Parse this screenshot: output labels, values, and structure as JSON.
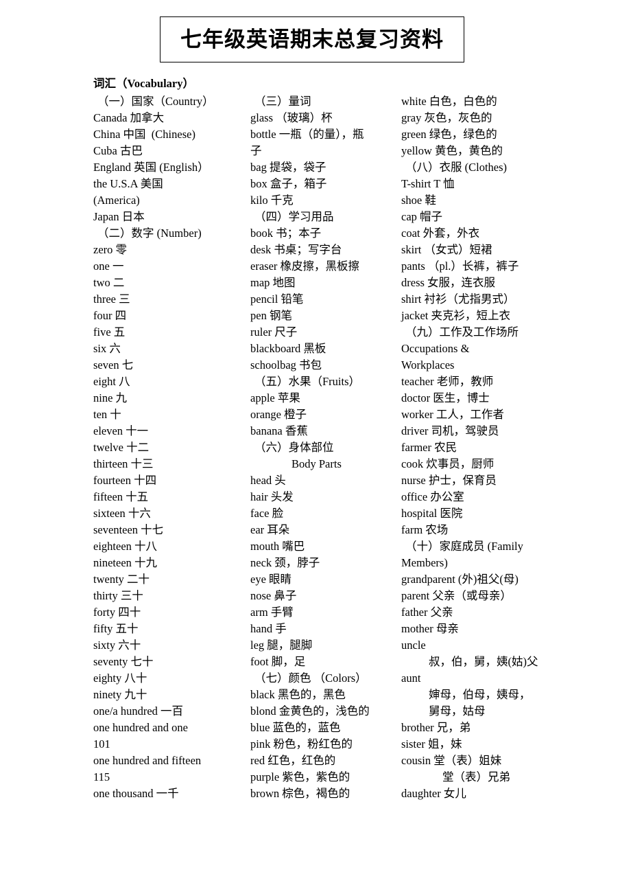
{
  "document": {
    "title": "七年级英语期末总复习资料",
    "section_heading": "词汇（Vocabulary）"
  },
  "columns": {
    "column_1": [
      {
        "text": "（一）国家（Country）",
        "style": "section"
      },
      {
        "text": "Canada 加拿大",
        "style": ""
      },
      {
        "text": "China 中国  (Chinese)",
        "style": ""
      },
      {
        "text": "Cuba 古巴",
        "style": ""
      },
      {
        "text": "England 英国 (English）",
        "style": ""
      },
      {
        "text": "the U.S.A 美国",
        "style": ""
      },
      {
        "text": "(America)",
        "style": ""
      },
      {
        "text": "Japan 日本",
        "style": ""
      },
      {
        "text": "（二）数字 (Number)",
        "style": "section"
      },
      {
        "text": "zero 零",
        "style": ""
      },
      {
        "text": "one 一",
        "style": ""
      },
      {
        "text": "two 二",
        "style": ""
      },
      {
        "text": "three 三",
        "style": ""
      },
      {
        "text": "four 四",
        "style": ""
      },
      {
        "text": "five 五",
        "style": ""
      },
      {
        "text": "six 六",
        "style": ""
      },
      {
        "text": "seven 七",
        "style": ""
      },
      {
        "text": "eight 八",
        "style": ""
      },
      {
        "text": "nine 九",
        "style": ""
      },
      {
        "text": "ten 十",
        "style": ""
      },
      {
        "text": "eleven 十一",
        "style": ""
      },
      {
        "text": "twelve 十二",
        "style": ""
      },
      {
        "text": "thirteen 十三",
        "style": ""
      },
      {
        "text": "fourteen 十四",
        "style": ""
      },
      {
        "text": "fifteen 十五",
        "style": ""
      },
      {
        "text": "sixteen 十六",
        "style": ""
      },
      {
        "text": "seventeen 十七",
        "style": ""
      },
      {
        "text": "eighteen 十八",
        "style": ""
      },
      {
        "text": "nineteen 十九",
        "style": ""
      },
      {
        "text": "twenty 二十",
        "style": ""
      },
      {
        "text": "thirty 三十",
        "style": ""
      },
      {
        "text": "forty 四十",
        "style": ""
      },
      {
        "text": "fifty 五十",
        "style": ""
      },
      {
        "text": "sixty 六十",
        "style": ""
      },
      {
        "text": "seventy 七十",
        "style": ""
      },
      {
        "text": "eighty 八十",
        "style": ""
      },
      {
        "text": "ninety 九十",
        "style": ""
      },
      {
        "text": "one/a hundred 一百",
        "style": ""
      },
      {
        "text": "one hundred and one",
        "style": ""
      },
      {
        "text": "101",
        "style": ""
      },
      {
        "text": "one hundred and fifteen",
        "style": ""
      },
      {
        "text": "115",
        "style": ""
      },
      {
        "text": "one thousand 一千",
        "style": ""
      }
    ],
    "column_2": [
      {
        "text": "（三）量词",
        "style": "section"
      },
      {
        "text": "glass （玻璃）杯",
        "style": ""
      },
      {
        "text": "bottle 一瓶（的量），瓶",
        "style": ""
      },
      {
        "text": "子",
        "style": ""
      },
      {
        "text": "bag 提袋，袋子",
        "style": ""
      },
      {
        "text": "box 盒子，箱子",
        "style": ""
      },
      {
        "text": "kilo 千克",
        "style": ""
      },
      {
        "text": "（四）学习用品",
        "style": "section"
      },
      {
        "text": "book 书；本子",
        "style": ""
      },
      {
        "text": "desk 书桌；写字台",
        "style": ""
      },
      {
        "text": "eraser 橡皮擦，黑板擦",
        "style": ""
      },
      {
        "text": "map 地图",
        "style": ""
      },
      {
        "text": "pencil 铅笔",
        "style": ""
      },
      {
        "text": "pen 钢笔",
        "style": ""
      },
      {
        "text": "ruler 尺子",
        "style": ""
      },
      {
        "text": "blackboard 黑板",
        "style": ""
      },
      {
        "text": "schoolbag 书包",
        "style": ""
      },
      {
        "text": "（五）水果（Fruits）",
        "style": "section"
      },
      {
        "text": "apple 苹果",
        "style": ""
      },
      {
        "text": "orange 橙子",
        "style": ""
      },
      {
        "text": "banana 香蕉",
        "style": ""
      },
      {
        "text": "（六）身体部位",
        "style": "section"
      },
      {
        "text": "Body Parts",
        "style": "indent-lg"
      },
      {
        "text": "head 头",
        "style": ""
      },
      {
        "text": "hair 头发",
        "style": ""
      },
      {
        "text": "face 脸",
        "style": ""
      },
      {
        "text": "ear 耳朵",
        "style": ""
      },
      {
        "text": "mouth 嘴巴",
        "style": ""
      },
      {
        "text": "neck 颈，脖子",
        "style": ""
      },
      {
        "text": "eye 眼睛",
        "style": ""
      },
      {
        "text": "nose 鼻子",
        "style": ""
      },
      {
        "text": "arm 手臂",
        "style": ""
      },
      {
        "text": "hand 手",
        "style": ""
      },
      {
        "text": "leg 腿，腿脚",
        "style": ""
      },
      {
        "text": "foot 脚，足",
        "style": ""
      },
      {
        "text": "（七）颜色 （Colors）",
        "style": "section"
      },
      {
        "text": "black 黑色的，黑色",
        "style": ""
      },
      {
        "text": "blond 金黄色的，浅色的",
        "style": ""
      },
      {
        "text": "blue 蓝色的，蓝色",
        "style": ""
      },
      {
        "text": "pink 粉色，粉红色的",
        "style": ""
      },
      {
        "text": "red 红色，红色的",
        "style": ""
      },
      {
        "text": "purple 紫色，紫色的",
        "style": ""
      },
      {
        "text": "brown 棕色，褐色的",
        "style": ""
      }
    ],
    "column_3": [
      {
        "text": "white 白色，白色的",
        "style": ""
      },
      {
        "text": "gray 灰色，灰色的",
        "style": ""
      },
      {
        "text": "green 绿色，绿色的",
        "style": ""
      },
      {
        "text": "yellow 黄色，黄色的",
        "style": ""
      },
      {
        "text": "（八）衣服 (Clothes)",
        "style": "section"
      },
      {
        "text": "T-shirt T 恤",
        "style": ""
      },
      {
        "text": "shoe 鞋",
        "style": ""
      },
      {
        "text": "cap 帽子",
        "style": ""
      },
      {
        "text": "coat 外套，外衣",
        "style": ""
      },
      {
        "text": "skirt （女式）短裙",
        "style": ""
      },
      {
        "text": "pants （pl.）长裤，裤子",
        "style": ""
      },
      {
        "text": "dress 女服，连衣服",
        "style": ""
      },
      {
        "text": "shirt 衬衫（尤指男式）",
        "style": ""
      },
      {
        "text": "jacket 夹克衫，短上衣",
        "style": ""
      },
      {
        "text": "（九）工作及工作场所",
        "style": "section"
      },
      {
        "text": "Occupations &",
        "style": ""
      },
      {
        "text": "Workplaces",
        "style": ""
      },
      {
        "text": "teacher 老师，教师",
        "style": ""
      },
      {
        "text": "doctor 医生，博士",
        "style": ""
      },
      {
        "text": "worker 工人，工作者",
        "style": ""
      },
      {
        "text": "driver 司机，驾驶员",
        "style": ""
      },
      {
        "text": "farmer 农民",
        "style": ""
      },
      {
        "text": "cook 炊事员，厨师",
        "style": ""
      },
      {
        "text": "nurse 护士，保育员",
        "style": ""
      },
      {
        "text": "office 办公室",
        "style": ""
      },
      {
        "text": "hospital 医院",
        "style": ""
      },
      {
        "text": "farm 农场",
        "style": ""
      },
      {
        "text": "（十）家庭成员 (Family",
        "style": "section"
      },
      {
        "text": "Members)",
        "style": ""
      },
      {
        "text": "grandparent (外)祖父(母)",
        "style": ""
      },
      {
        "text": "parent 父亲（或母亲）",
        "style": ""
      },
      {
        "text": "father 父亲",
        "style": ""
      },
      {
        "text": "mother 母亲",
        "style": ""
      },
      {
        "text": "uncle",
        "style": ""
      },
      {
        "text": "叔，伯，舅，姨(姑)父",
        "style": "indent-md"
      },
      {
        "text": "aunt",
        "style": ""
      },
      {
        "text": "婶母，伯母，姨母，",
        "style": "indent-md"
      },
      {
        "text": "舅母，姑母",
        "style": "indent-md"
      },
      {
        "text": "brother 兄，弟",
        "style": ""
      },
      {
        "text": "sister 姐，妹",
        "style": ""
      },
      {
        "text": "cousin 堂（表）姐妹",
        "style": ""
      },
      {
        "text": "堂（表）兄弟",
        "style": "indent-lg"
      },
      {
        "text": "daughter 女儿",
        "style": ""
      }
    ]
  }
}
